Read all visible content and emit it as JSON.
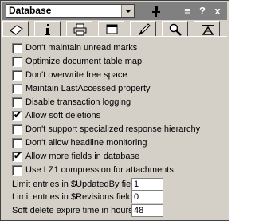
{
  "title": {
    "selected": "Database"
  },
  "titlebar_buttons": {
    "menu": "≡",
    "help": "?",
    "close": "x"
  },
  "tabs": [
    {
      "name": "basics"
    },
    {
      "name": "info"
    },
    {
      "name": "print"
    },
    {
      "name": "design"
    },
    {
      "name": "launch"
    },
    {
      "name": "full-text"
    },
    {
      "name": "advanced"
    }
  ],
  "options": [
    {
      "label": "Don't maintain unread marks",
      "checked": false
    },
    {
      "label": "Optimize document table map",
      "checked": false
    },
    {
      "label": "Don't overwrite free space",
      "checked": false
    },
    {
      "label": "Maintain LastAccessed property",
      "checked": false
    },
    {
      "label": "Disable transaction logging",
      "checked": false
    },
    {
      "label": "Allow soft deletions",
      "checked": true
    },
    {
      "label": "Don't support specialized response hierarchy",
      "checked": false
    },
    {
      "label": "Don't allow headline monitoring",
      "checked": false
    },
    {
      "label": "Allow more fields in database",
      "checked": true
    },
    {
      "label": "Use LZ1 compression for attachments",
      "checked": false
    }
  ],
  "fields": [
    {
      "label": "Limit entries in $UpdatedBy fields",
      "value": "1"
    },
    {
      "label": "Limit entries in $Revisions fields",
      "value": "0"
    },
    {
      "label": "Soft delete expire time in hours",
      "value": "48"
    }
  ],
  "check_glyph": "✔"
}
